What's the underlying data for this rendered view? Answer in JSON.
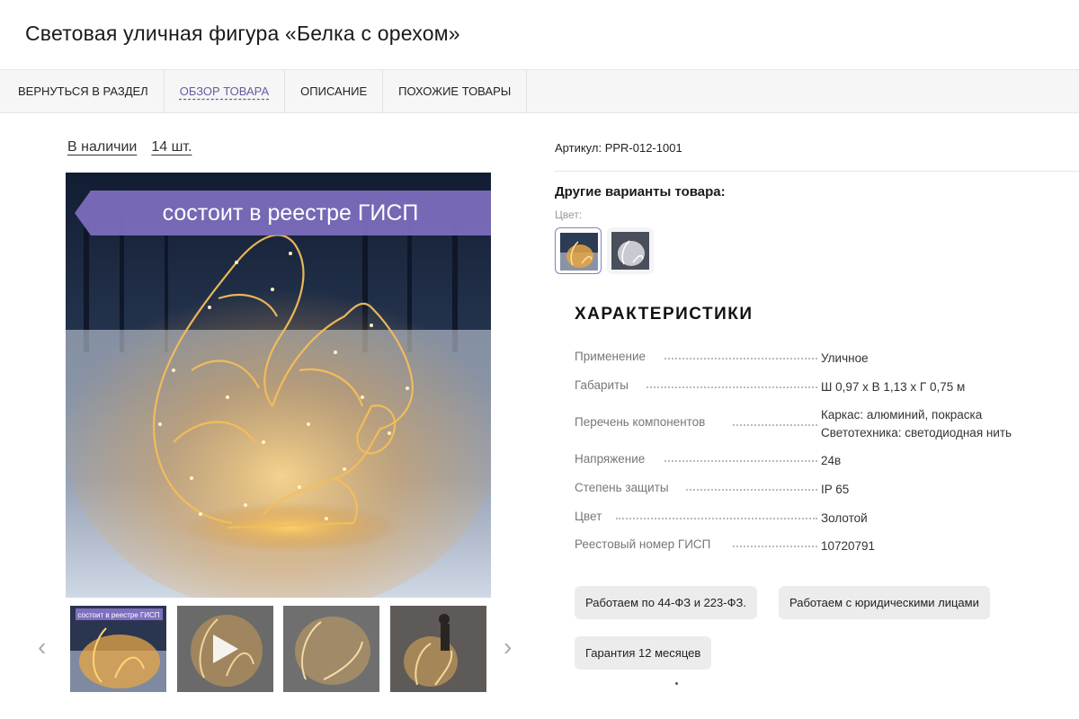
{
  "product": {
    "title": "Световая уличная фигура «Белка с орехом»"
  },
  "tabs": [
    {
      "label": "ВЕРНУТЬСЯ В РАЗДЕЛ",
      "active": false
    },
    {
      "label": "ОБЗОР ТОВАРА",
      "active": true
    },
    {
      "label": "ОПИСАНИЕ",
      "active": false
    },
    {
      "label": "ПОХОЖИЕ ТОВАРЫ",
      "active": false
    }
  ],
  "stock": {
    "status": "В наличии",
    "quantity": "14 шт."
  },
  "gallery": {
    "banner_text": "состоит в реестре ГИСП",
    "thumb_banner_text": "состоит в реестре ГИСП",
    "prev_icon": "chevron-left-icon",
    "next_icon": "chevron-right-icon",
    "play_icon": "play-icon"
  },
  "sku": {
    "text": "Артикул: PPR-012-1001"
  },
  "variants": {
    "title": "Другие варианты товара:",
    "color_label": "Цвет:"
  },
  "characteristics": {
    "title": "ХАРАКТЕРИСТИКИ",
    "rows": [
      {
        "name": "Применение",
        "value": "Уличное"
      },
      {
        "name": "Габариты",
        "value": "Ш 0,97 х В 1,13 х Г 0,75 м"
      },
      {
        "name": "Перечень компонентов",
        "value": "Каркас: алюминий, покраска",
        "value2": "Светотехника: светодиодная нить"
      },
      {
        "name": "Напряжение",
        "value": "24в"
      },
      {
        "name": "Степень защиты",
        "value": "IP 65"
      },
      {
        "name": "Цвет",
        "value": "Золотой"
      },
      {
        "name": "Реестовый номер ГИСП",
        "value": "10720791"
      }
    ]
  },
  "badges": [
    "Работаем по 44-ФЗ и 223-ФЗ.",
    "Работаем с юридическими лицами",
    "Гарантия 12 месяцев"
  ],
  "colors": {
    "accent": "#6a5aa0",
    "banner": "#7f6fc0",
    "gold": "#f0b84a"
  }
}
